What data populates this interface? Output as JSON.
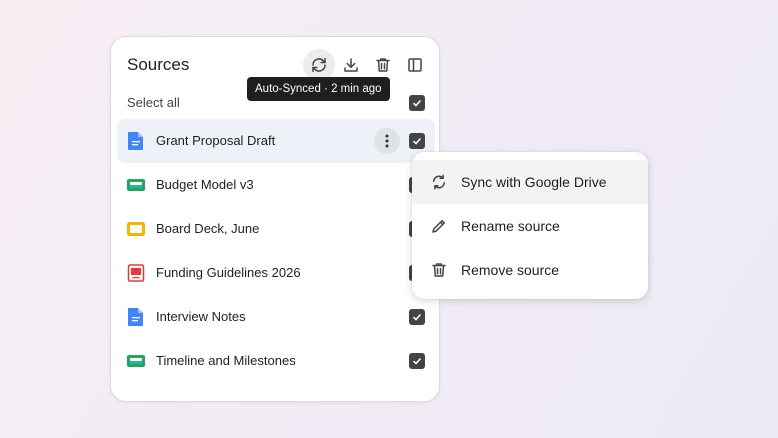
{
  "panel": {
    "title": "Sources",
    "select_all_label": "Select all",
    "toolbar": [
      {
        "name": "sync-button",
        "icon": "sync-icon",
        "active": true
      },
      {
        "name": "download-button",
        "icon": "download-icon"
      },
      {
        "name": "delete-button",
        "icon": "trash-icon"
      },
      {
        "name": "collapse-panel-button",
        "icon": "sidebar-panel-icon"
      }
    ],
    "tooltip": "Auto-Synced · 2 min ago",
    "sources": [
      {
        "label": "Grant Proposal Draft",
        "icon": "google-docs-icon",
        "checked": true,
        "selected": true
      },
      {
        "label": "Budget Model v3",
        "icon": "google-sheets-icon",
        "checked": true
      },
      {
        "label": "Board Deck, June",
        "icon": "google-slides-icon",
        "checked": true
      },
      {
        "label": "Funding Guidelines 2026",
        "icon": "pdf-icon",
        "checked": true
      },
      {
        "label": "Interview Notes",
        "icon": "google-docs-icon",
        "checked": true
      },
      {
        "label": "Timeline and Milestones",
        "icon": "google-sheets-icon",
        "checked": true
      }
    ]
  },
  "context_menu": {
    "items": [
      {
        "label": "Sync with Google Drive",
        "icon": "sync-icon"
      },
      {
        "label": "Rename source",
        "icon": "pencil-icon"
      },
      {
        "label": "Remove source",
        "icon": "trash-icon"
      }
    ]
  },
  "colors": {
    "docs_blue": "#4285f4",
    "sheets_green": "#23a566",
    "slides_yellow": "#f4b400",
    "pdf_red": "#e53935",
    "checkbox": "#444444",
    "selected_row": "#eef2f8"
  }
}
